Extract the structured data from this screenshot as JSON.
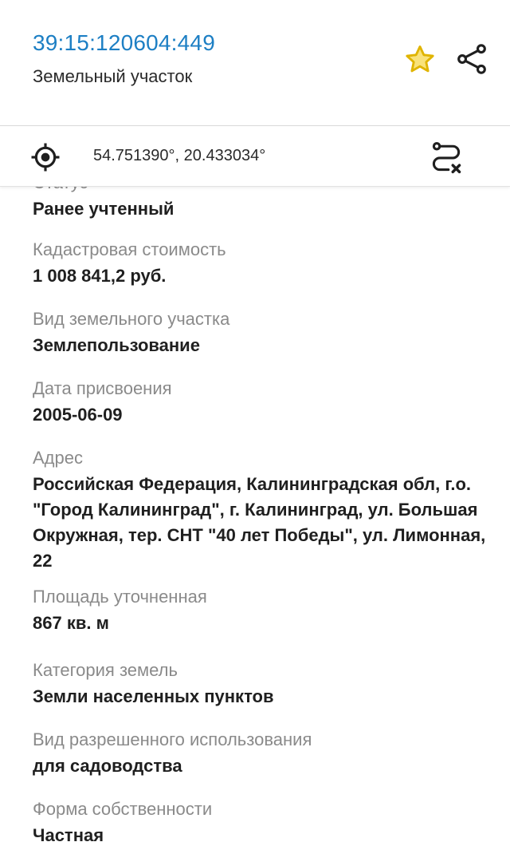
{
  "header": {
    "cadastral_number": "39:15:120604:449",
    "object_type": "Земельный участок",
    "favorite_icon": "star-outline-icon",
    "share_icon": "share-icon",
    "accent_color": "#1d7fc4",
    "star_color": "#f2c200"
  },
  "coords_bar": {
    "coordinates": "54.751390°, 20.433034°",
    "locate_icon": "crosshair-icon",
    "route_icon": "route-icon"
  },
  "details": {
    "status_label_partial": "Статус",
    "status_value": "Ранее учтенный",
    "properties": [
      {
        "label": "Кадастровая стоимость",
        "value": "1 008 841,2 руб."
      },
      {
        "label": "Вид земельного участка",
        "value": "Землепользование"
      },
      {
        "label": "Дата присвоения",
        "value": "2005-06-09"
      },
      {
        "label": "Адрес",
        "value": "Российская Федерация, Калининградская обл, г.о. \"Город Калининград\", г. Калининград, ул. Большая Окружная, тер. СНТ \"40 лет Победы\", ул. Лимонная, 22"
      },
      {
        "label": "Площадь уточненная",
        "value": "867 кв. м"
      },
      {
        "label": "Категория земель",
        "value": "Земли населенных пунктов"
      },
      {
        "label": "Вид разрешенного использования",
        "value": "для садоводства"
      },
      {
        "label": "Форма собственности",
        "value": "Частная"
      }
    ]
  }
}
